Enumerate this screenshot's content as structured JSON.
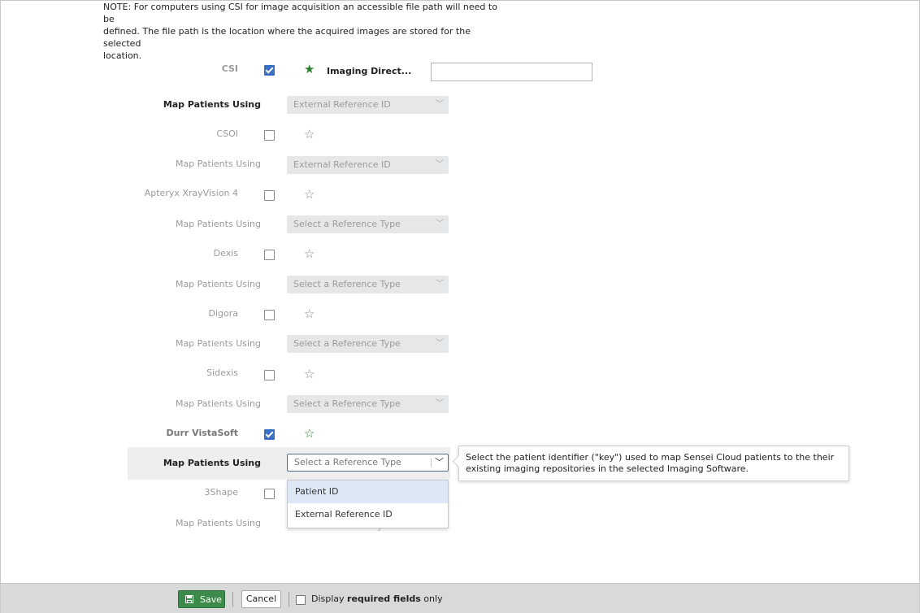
{
  "note": {
    "line1": "NOTE: For computers using CSI for image acquisition an accessible file path will need to be",
    "line2": "defined. The file path is the location where the acquired images are stored for the selected",
    "line3": "location."
  },
  "software": [
    {
      "name": "CSI",
      "checked": true,
      "starred": true,
      "map_label": "Map Patients Using",
      "map_value": "External Reference ID"
    },
    {
      "name": "CSOI",
      "checked": false,
      "starred": false,
      "map_label": "Map Patients Using",
      "map_value": "External Reference ID"
    },
    {
      "name": "Apteryx XrayVision 4",
      "checked": false,
      "starred": false,
      "map_label": "Map Patients Using",
      "map_value": "Select a Reference Type"
    },
    {
      "name": "Dexis",
      "checked": false,
      "starred": false,
      "map_label": "Map Patients Using",
      "map_value": "Select a Reference Type"
    },
    {
      "name": "Digora",
      "checked": false,
      "starred": false,
      "map_label": "Map Patients Using",
      "map_value": "Select a Reference Type"
    },
    {
      "name": "Sidexis",
      "checked": false,
      "starred": false,
      "map_label": "Map Patients Using",
      "map_value": "Select a Reference Type"
    },
    {
      "name": "Durr VistaSoft",
      "checked": true,
      "starred": false,
      "map_label": "Map Patients Using",
      "map_value": "Select a Reference Type"
    },
    {
      "name": "3Shape",
      "checked": false,
      "starred": false,
      "map_label": "Map Patients Using",
      "map_value": ""
    }
  ],
  "imaging_directory": {
    "label": "Imaging Direct...",
    "value": ""
  },
  "dropdown": {
    "options": [
      "Patient ID",
      "External Reference ID"
    ],
    "highlighted": "Patient ID"
  },
  "tooltip": {
    "line1": "Select the patient identifier (\"key\") used to map Sensei Cloud patients to the their",
    "line2": "existing imaging repositories in the selected Imaging Software."
  },
  "footer": {
    "save_label": "Save",
    "cancel_label": "Cancel",
    "display_prefix": "Display ",
    "display_bold": "required fields",
    "display_suffix": " only"
  },
  "icons": {
    "star_filled": "star-filled-icon",
    "star_outline": "star-outline-icon",
    "chevron": "chevron-down-icon",
    "save": "floppy-disk-icon"
  },
  "colors": {
    "save_green": "#3d8b4a",
    "checkbox_blue": "#3a6fc4",
    "star_green": "#2e7d32"
  }
}
